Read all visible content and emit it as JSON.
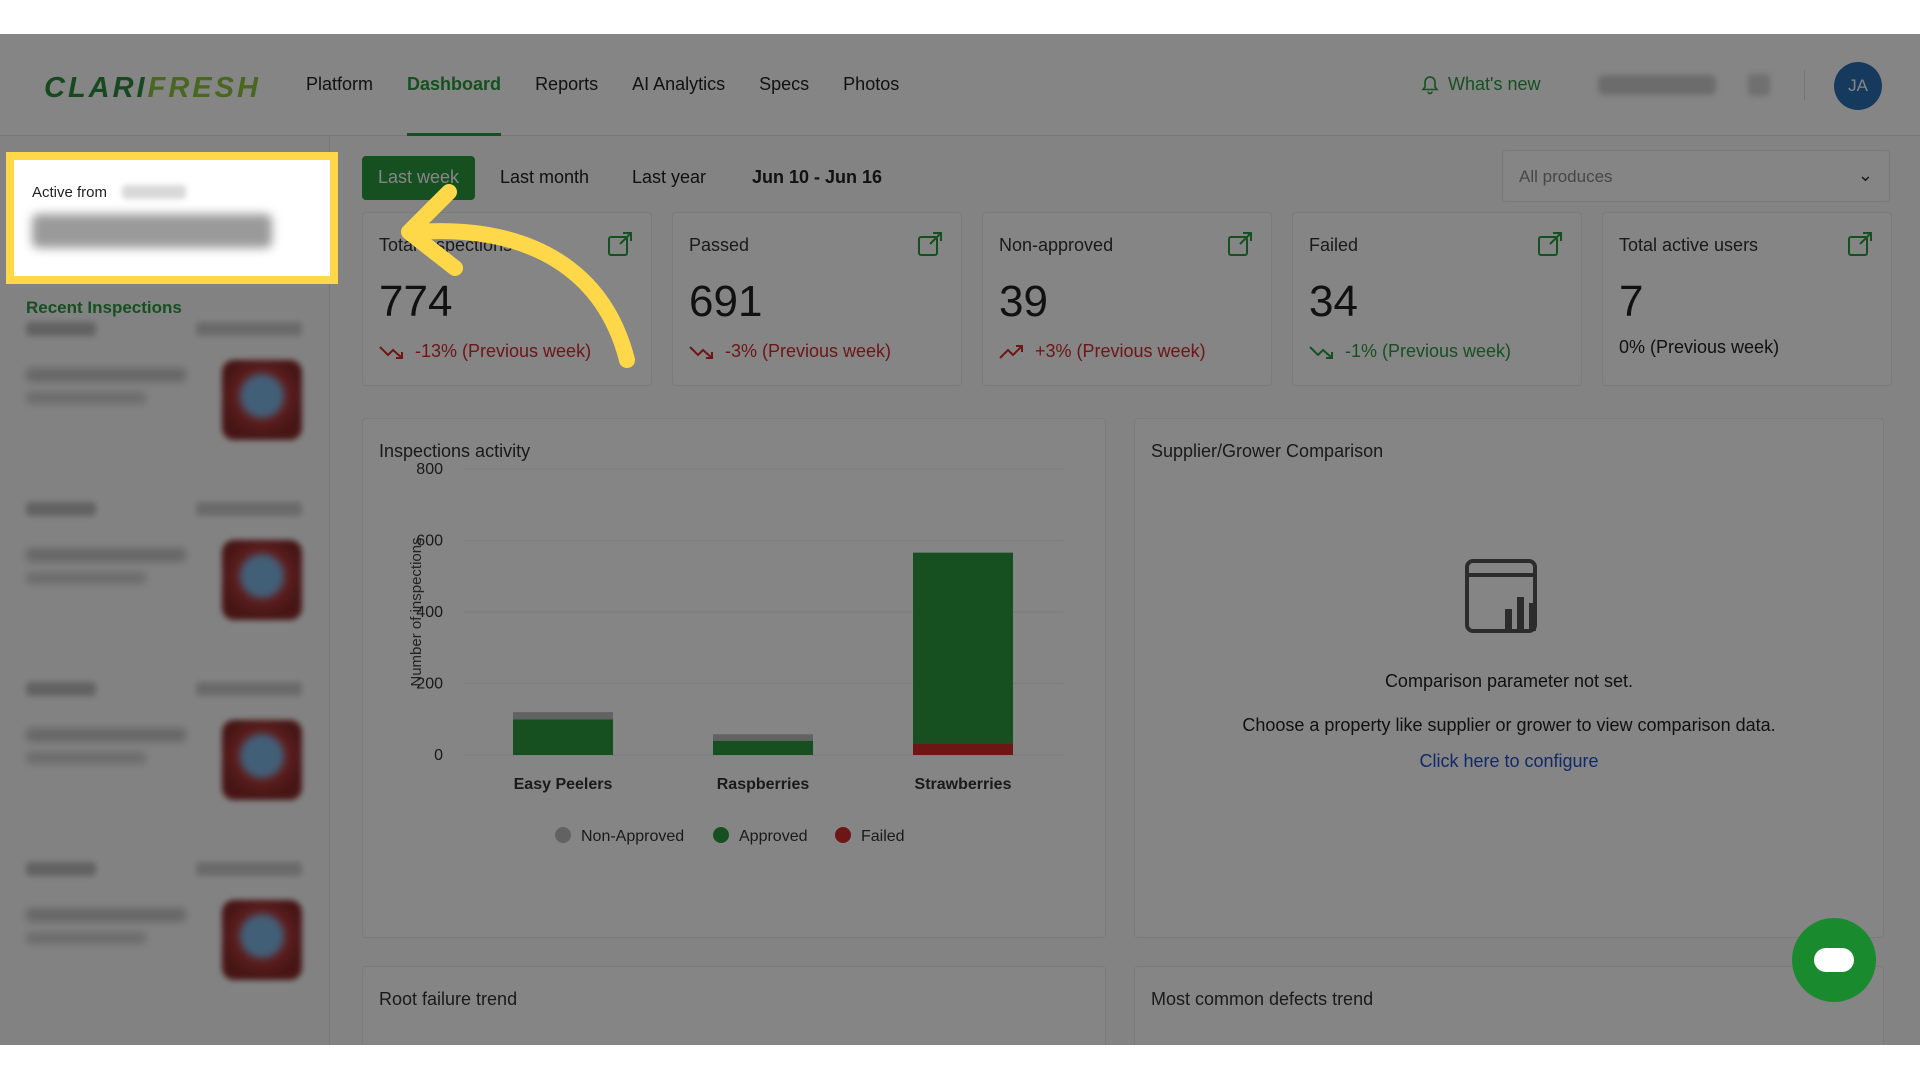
{
  "app": {
    "logo_part1": "CLARI",
    "logo_part2": "FRESH"
  },
  "nav": {
    "items": [
      {
        "label": "Platform",
        "active": false
      },
      {
        "label": "Dashboard",
        "active": true
      },
      {
        "label": "Reports",
        "active": false
      },
      {
        "label": "AI Analytics",
        "active": false
      },
      {
        "label": "Specs",
        "active": false
      },
      {
        "label": "Photos",
        "active": false
      }
    ],
    "whats_new": "What's new",
    "avatar_initials": "JA"
  },
  "sidebar": {
    "active_from_label": "Active from",
    "recent_inspections_label": "Recent Inspections"
  },
  "filters": {
    "periods": [
      "Last week",
      "Last month",
      "Last year"
    ],
    "active_period": "Last week",
    "date_range": "Jun 10 - Jun 16",
    "produce_select": "All produces"
  },
  "stats": [
    {
      "title": "Total inspections",
      "value": "774",
      "delta": "-13% (Previous week)",
      "trend": "down",
      "tone": "bad"
    },
    {
      "title": "Passed",
      "value": "691",
      "delta": "-3% (Previous week)",
      "trend": "down",
      "tone": "bad"
    },
    {
      "title": "Non-approved",
      "value": "39",
      "delta": "+3% (Previous week)",
      "trend": "up",
      "tone": "bad"
    },
    {
      "title": "Failed",
      "value": "34",
      "delta": "-1% (Previous week)",
      "trend": "down",
      "tone": "good"
    },
    {
      "title": "Total active users",
      "value": "7",
      "delta": "0% (Previous week)",
      "trend": "none",
      "tone": "plain"
    }
  ],
  "activity_panel": {
    "title": "Inspections activity"
  },
  "comparison_panel": {
    "title": "Supplier/Grower Comparison",
    "empty_title": "Comparison parameter not set.",
    "empty_desc": "Choose a property like supplier or grower to view comparison data.",
    "configure_link": "Click here to configure"
  },
  "bottom_panels": {
    "left_title": "Root failure trend",
    "right_title": "Most common defects trend"
  },
  "colors": {
    "approved": "#2b9a3e",
    "failed": "#d32a2a",
    "non_approved": "#bdbdbd",
    "brand": "#2b9a3e",
    "link": "#1f4fc8"
  },
  "chart_data": {
    "type": "bar",
    "stacked": true,
    "categories": [
      "Easy Peelers",
      "Raspberries",
      "Strawberries"
    ],
    "series": [
      {
        "name": "Failed",
        "values": [
          0,
          0,
          33
        ]
      },
      {
        "name": "Approved",
        "values": [
          100,
          40,
          533
        ]
      },
      {
        "name": "Non-Approved",
        "values": [
          20,
          18,
          0
        ]
      }
    ],
    "ylabel": "Number of inspections",
    "ylim": [
      0,
      800
    ],
    "yticks": [
      0,
      200,
      400,
      600,
      800
    ],
    "legend": [
      "Non-Approved",
      "Approved",
      "Failed"
    ],
    "legend_position": "bottom"
  }
}
